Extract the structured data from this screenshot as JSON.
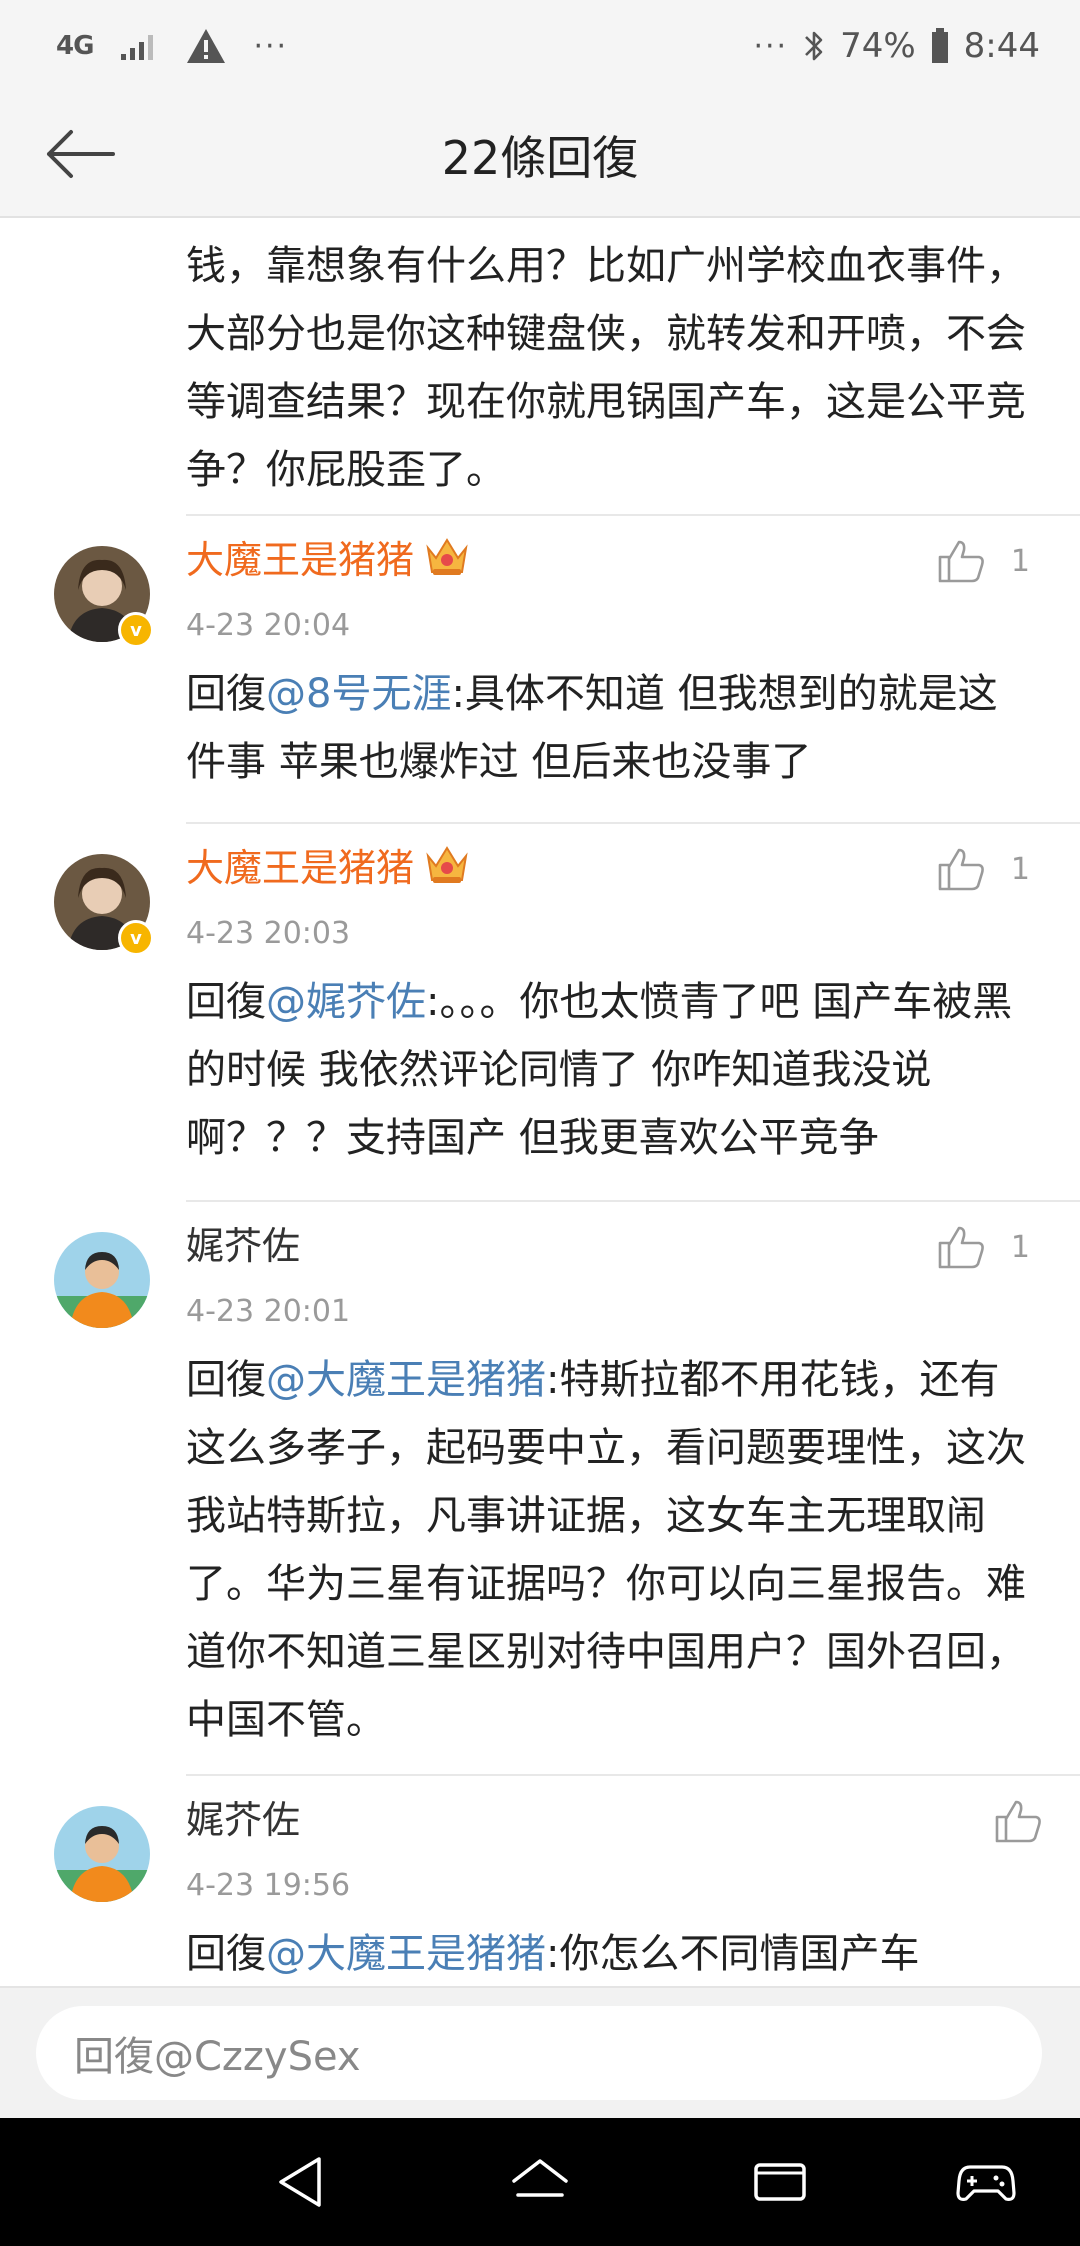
{
  "status_bar": {
    "network": "4G",
    "overflow_left": "···",
    "overflow_right": "···",
    "battery": "74%",
    "time": "8:44"
  },
  "header": {
    "title": "22條回復"
  },
  "continuation": {
    "text": "钱，靠想象有什么用？比如广州学校血衣事件，大部分也是你这种键盘侠，就转发和开喷，不会等调查结果？现在你就甩锅国产车，这是公平竞争？你屁股歪了。"
  },
  "comments": [
    {
      "username": "大魔王是猪猪",
      "time": "4-23 20:04",
      "likes": "1",
      "reply_prefix": "回復",
      "mention": "@8号无涯",
      "text": ":具体不知道 但我想到的就是这件事 苹果也爆炸过 但后来也没事了"
    },
    {
      "username": "大魔王是猪猪",
      "time": "4-23 20:03",
      "likes": "1",
      "reply_prefix": "回復",
      "mention": "@娓芥佐",
      "text": ":。。。你也太愤青了吧 国产车被黑的时候 我依然评论同情了 你咋知道我没说啊？？？支持国产 但我更喜欢公平竞争"
    },
    {
      "username": "娓芥佐",
      "time": "4-23 20:01",
      "likes": "1",
      "reply_prefix": "回復",
      "mention": "@大魔王是猪猪",
      "text": ":特斯拉都不用花钱，还有这么多孝子，起码要中立，看问题要理性，这次我站特斯拉，凡事讲证据，这女车主无理取闹了。华为三星有证据吗？你可以向三星报告。难道你不知道三星区别对待中国用户？国外召回，中国不管。"
    },
    {
      "username": "娓芥佐",
      "time": "4-23 19:56",
      "likes": "",
      "reply_prefix": "回復",
      "mention": "@大魔王是猪猪",
      "text": ":你怎么不同情国产车"
    }
  ],
  "reply_bar": {
    "placeholder": "回復@CzzySex"
  },
  "colors": {
    "vip_name": "#f06a1e",
    "mention": "#4a7fb5",
    "timestamp": "#9a9a9a",
    "badge": "#f7b500"
  }
}
